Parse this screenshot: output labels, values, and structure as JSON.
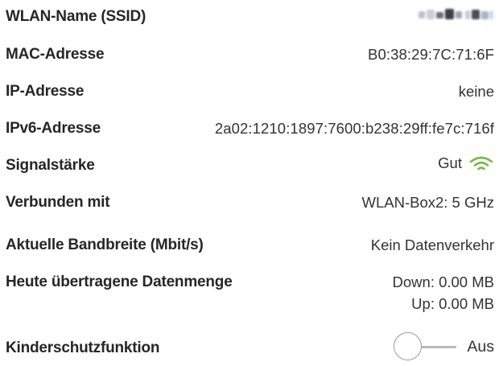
{
  "rows": {
    "ssid": {
      "label": "WLAN-Name (SSID)"
    },
    "mac": {
      "label": "MAC-Adresse",
      "value": "B0:38:29:7C:71:6F"
    },
    "ip": {
      "label": "IP-Adresse",
      "value": "keine"
    },
    "ipv6": {
      "label": "IPv6-Adresse",
      "value": "2a02:1210:1897:7600:b238:29ff:fe7c:716f"
    },
    "signal": {
      "label": "Signalstärke",
      "value": "Gut",
      "icon": "wifi-signal-icon",
      "icon_color": "#7ab648"
    },
    "connected": {
      "label": "Verbunden mit",
      "value": "WLAN-Box2: 5 GHz"
    },
    "bandwidth": {
      "label": "Aktuelle Bandbreite (Mbit/s)",
      "value": "Kein Datenverkehr"
    },
    "transferred": {
      "label": "Heute übertragene Datenmenge",
      "down": "Down: 0.00 MB",
      "up": "Up: 0.00 MB"
    },
    "parental": {
      "label": "Kinderschutzfunktion",
      "toggle_state": "Aus"
    }
  }
}
